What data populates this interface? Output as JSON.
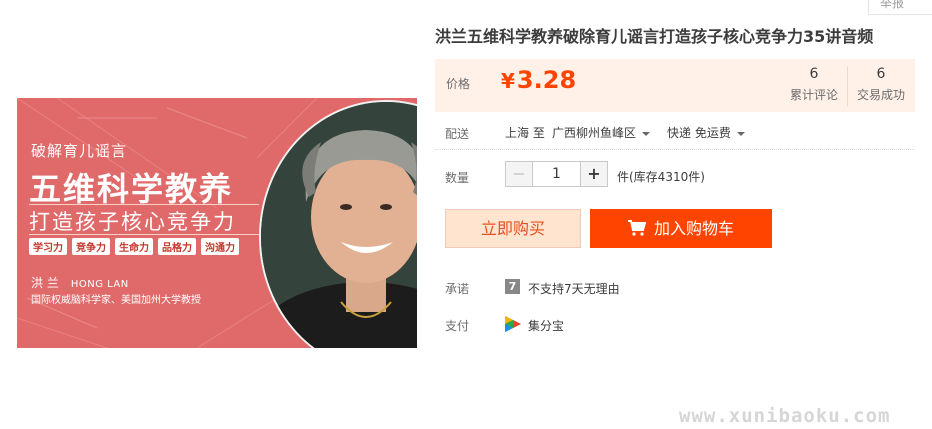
{
  "report": {
    "label": "举报"
  },
  "product": {
    "title": "洪兰五维科学教养破除育儿谣言打造孩子核心竞争力35讲音频",
    "image": {
      "subtitle": "破解育儿谣言",
      "headline": "五维科学教养",
      "slogan": "打造孩子核心竞争力",
      "tags": [
        "学习力",
        "竞争力",
        "生命力",
        "品格力",
        "沟通力"
      ],
      "author_cn": "洪 兰",
      "author_en": "HONG LAN",
      "author_desc": "国际权威脑科学家、美国加州大学教授"
    }
  },
  "price_box": {
    "label": "价格",
    "currency": "¥",
    "amount": "3.28",
    "reviews": {
      "count": "6",
      "label": "累计评论"
    },
    "sales": {
      "count": "6",
      "label": "交易成功"
    }
  },
  "shipping": {
    "label": "配送",
    "from": "上海 至",
    "to": "广西柳州鱼峰区",
    "method": "快递 免运费"
  },
  "quantity": {
    "label": "数量",
    "value": "1",
    "minus": "−",
    "plus": "+",
    "stock": "件(库存4310件)"
  },
  "actions": {
    "buy_now": "立即购买",
    "add_to_cart": "加入购物车"
  },
  "promise": {
    "label": "承诺",
    "icon_glyph": "7",
    "text": "不支持7天无理由"
  },
  "payment": {
    "label": "支付",
    "text": "集分宝"
  },
  "watermark": "www.xunibaoku.com",
  "colors": {
    "accent": "#ff4400",
    "price_bg": "#fff0e8",
    "banner_bg": "#e06a6a"
  }
}
